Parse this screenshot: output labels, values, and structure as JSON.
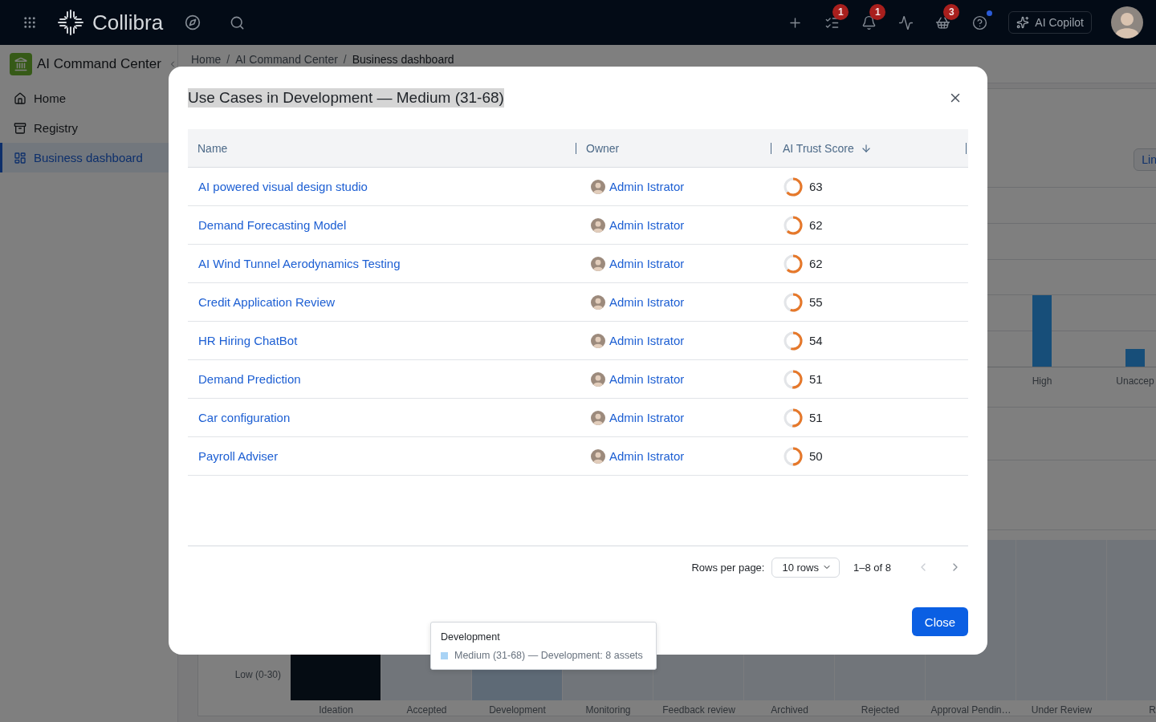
{
  "top_bar": {
    "brand": "Collibra",
    "actions": [
      {
        "kind": "add",
        "dot": false
      },
      {
        "kind": "tasks",
        "badge": "1",
        "dot": false
      },
      {
        "kind": "notifications",
        "badge": "1",
        "dot": false
      },
      {
        "kind": "activity",
        "dot": false
      },
      {
        "kind": "basket",
        "badge": "3",
        "dot": false
      },
      {
        "kind": "help",
        "dot": true
      }
    ],
    "copilot_button": "AI Copilot"
  },
  "sidebar": {
    "title": "AI Command Center",
    "items": [
      {
        "label": "Home",
        "kind": "home",
        "selected": false
      },
      {
        "label": "Registry",
        "kind": "registry",
        "selected": false
      },
      {
        "label": "Business dashboard",
        "kind": "dashboard",
        "selected": true
      }
    ]
  },
  "breadcrumb": {
    "items": [
      {
        "label": "Home",
        "current": false,
        "separator": "/"
      },
      {
        "label": "AI Command Center",
        "current": false,
        "separator": "/"
      },
      {
        "label": "Business dashboard",
        "current": true
      }
    ]
  },
  "dashboard": {
    "view_button": "Lin",
    "risk_chart": {
      "categories": [
        "High",
        "Unaccep"
      ]
    },
    "heatmap": {
      "row_label": "Low (0-30)",
      "columns": [
        "Ideation",
        "Accepted",
        "Development",
        "Monitoring",
        "Feedback review",
        "Archived",
        "Rejected",
        "Approval Pendin…",
        "Under Review",
        "R"
      ]
    }
  },
  "modal": {
    "title": "Use Cases in Development — Medium (31-68)",
    "columns": [
      {
        "label": "Name",
        "sorted": false
      },
      {
        "label": "Owner",
        "sorted": false
      },
      {
        "label": "AI Trust Score",
        "sorted": true
      }
    ],
    "rows": [
      {
        "name": "AI powered visual design studio",
        "owner": "Admin Istrator",
        "score": "63"
      },
      {
        "name": "Demand Forecasting Model",
        "owner": "Admin Istrator",
        "score": "62"
      },
      {
        "name": "AI Wind Tunnel Aerodynamics Testing",
        "owner": "Admin Istrator",
        "score": "62"
      },
      {
        "name": "Credit Application Review",
        "owner": "Admin Istrator",
        "score": "55"
      },
      {
        "name": "HR Hiring ChatBot",
        "owner": "Admin Istrator",
        "score": "54"
      },
      {
        "name": "Demand Prediction",
        "owner": "Admin Istrator",
        "score": "51"
      },
      {
        "name": "Car configuration",
        "owner": "Admin Istrator",
        "score": "51"
      },
      {
        "name": "Payroll Adviser",
        "owner": "Admin Istrator",
        "score": "50"
      }
    ],
    "pagination": {
      "rows_per_page_label": "Rows per page:",
      "rows_select": "10 rows",
      "range": "1–8 of 8",
      "previous_disabled": true,
      "next_disabled": false
    },
    "close_button": "Close"
  },
  "tooltip": {
    "title": "Development",
    "entry": "Medium (31-68) — Development: 8 assets",
    "color": "#a9d3f5"
  }
}
